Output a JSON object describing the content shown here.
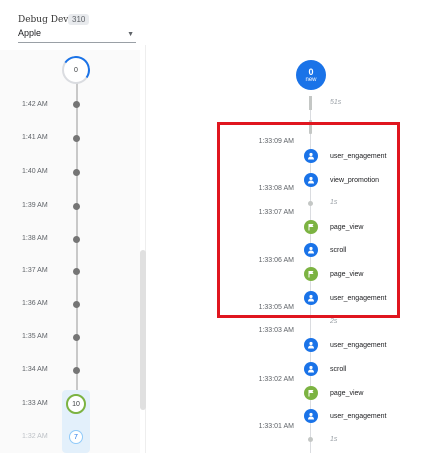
{
  "device": {
    "label": "Debug Device",
    "count": "310",
    "selected": "Apple"
  },
  "minutes": {
    "top_count": "0",
    "rows": [
      "1:42 AM",
      "1:41 AM",
      "1:40 AM",
      "1:39 AM",
      "1:38 AM",
      "1:37 AM",
      "1:36 AM",
      "1:35 AM",
      "1:34 AM",
      "1:33 AM",
      "1:32 AM"
    ],
    "current_count": "10",
    "next_count": "7"
  },
  "stream": {
    "new_count": "0",
    "new_label": "new",
    "gaps": [
      "51s",
      "1s",
      "2s",
      "1s"
    ],
    "times": [
      "1:33:09 AM",
      "1:33:08 AM",
      "1:33:07 AM",
      "1:33:06 AM",
      "1:33:05 AM",
      "1:33:03 AM",
      "1:33:02 AM",
      "1:33:01 AM"
    ],
    "events": [
      {
        "name": "user_engagement",
        "color": "blue"
      },
      {
        "name": "view_promotion",
        "color": "blue"
      },
      {
        "name": "page_view",
        "color": "green"
      },
      {
        "name": "scroll",
        "color": "blue"
      },
      {
        "name": "page_view",
        "color": "green"
      },
      {
        "name": "user_engagement",
        "color": "blue"
      },
      {
        "name": "user_engagement",
        "color": "blue"
      },
      {
        "name": "scroll",
        "color": "blue"
      },
      {
        "name": "page_view",
        "color": "green"
      },
      {
        "name": "user_engagement",
        "color": "blue"
      }
    ]
  },
  "colors": {
    "accent": "#1a73e8",
    "green": "#7cb342",
    "highlight": "#e0161f"
  }
}
